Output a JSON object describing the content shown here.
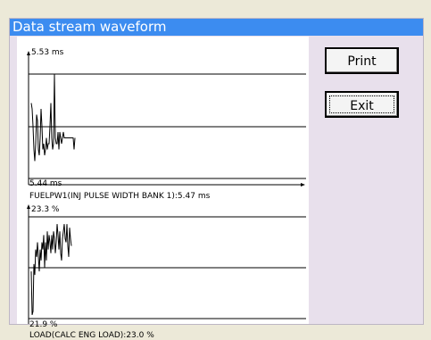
{
  "window": {
    "title": "Data stream waveform"
  },
  "charts": [
    {
      "top_label": "5.53 ms",
      "bottom_label": "5.44 ms",
      "caption": "FUELPW1(INJ PULSE WIDTH BANK 1):5.47 ms"
    },
    {
      "top_label": "23.3 %",
      "bottom_label": "21.9 %",
      "caption": "LOAD(CALC ENG LOAD):23.0 %"
    }
  ],
  "buttons": {
    "print_label": "Print",
    "exit_label": "Exit"
  },
  "chart_data": [
    {
      "type": "line",
      "title": "FUELPW1(INJ PULSE WIDTH BANK 1):5.47 ms",
      "ylim": [
        5.44,
        5.53
      ],
      "unit": "ms",
      "series": [
        {
          "x": [
            0,
            1,
            2,
            3,
            4,
            5,
            6,
            7,
            8,
            9,
            10,
            11,
            12,
            13,
            14,
            15,
            16,
            17,
            18,
            19,
            20,
            21,
            22,
            23,
            24,
            25,
            26,
            27,
            28,
            29,
            30,
            31,
            32,
            33,
            34,
            35,
            36,
            37,
            38,
            39,
            40,
            41,
            42,
            43,
            44,
            45,
            46,
            47,
            48,
            49
          ],
          "values": [
            5.505,
            5.5,
            5.485,
            5.465,
            5.455,
            5.47,
            5.495,
            5.49,
            5.465,
            5.46,
            5.475,
            5.5,
            5.485,
            5.465,
            5.47,
            5.46,
            5.465,
            5.475,
            5.465,
            5.47,
            5.47,
            5.485,
            5.505,
            5.475,
            5.465,
            5.47,
            5.53,
            5.475,
            5.47,
            5.47,
            5.48,
            5.465,
            5.48,
            5.475,
            5.47,
            5.475,
            5.48,
            5.475,
            5.475,
            5.475,
            5.475,
            5.475,
            5.475,
            5.475,
            5.475,
            5.475,
            5.475,
            5.475,
            5.465,
            5.475
          ]
        }
      ]
    },
    {
      "type": "line",
      "title": "LOAD(CALC ENG LOAD):23.0 %",
      "ylim": [
        21.9,
        23.3
      ],
      "unit": "%",
      "series": [
        {
          "x": [
            0,
            1,
            2,
            3,
            4,
            5,
            6,
            7,
            8,
            9,
            10,
            11,
            12,
            13,
            14,
            15,
            16,
            17,
            18,
            19,
            20,
            21,
            22,
            23,
            24,
            25,
            26,
            27,
            28,
            29,
            30,
            31,
            32,
            33,
            34,
            35,
            36,
            37,
            38,
            39,
            40,
            41,
            42,
            43,
            44,
            45
          ],
          "values": [
            22.55,
            21.95,
            22.0,
            22.65,
            22.5,
            22.85,
            22.75,
            22.95,
            22.75,
            22.55,
            22.85,
            22.7,
            22.95,
            22.85,
            23.05,
            22.6,
            22.95,
            22.7,
            23.1,
            22.85,
            23.05,
            22.95,
            22.8,
            23.05,
            22.85,
            23.1,
            23.0,
            22.8,
            22.95,
            23.2,
            23.05,
            22.85,
            23.1,
            22.8,
            22.7,
            23.0,
            23.1,
            23.2,
            23.0,
            22.95,
            23.2,
            22.9,
            22.75,
            23.15,
            23.0,
            22.9
          ]
        }
      ]
    }
  ]
}
